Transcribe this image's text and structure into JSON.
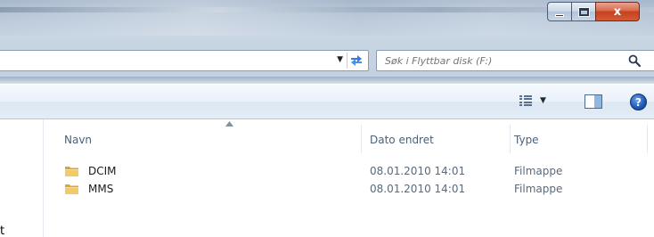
{
  "window": {
    "caption": {
      "minimize_icon": "minimize-icon",
      "maximize_icon": "maximize-icon",
      "close_label": "x"
    }
  },
  "address_bar": {
    "dropdown_icon": "chevron-down-icon",
    "refresh_icon": "refresh-icon"
  },
  "search": {
    "placeholder": "Søk i Flyttbar disk (F:)",
    "icon": "search-icon"
  },
  "command_bar": {
    "views_icon": "views-icon",
    "views_arrow": "▼",
    "preview_icon": "preview-pane-icon",
    "help_label": "?"
  },
  "columns": {
    "name": "Navn",
    "date": "Dato endret",
    "type": "Type",
    "sort_indicator": "^"
  },
  "files": [
    {
      "name": "DCIM",
      "date": "08.01.2010 14:01",
      "type": "Filmappe",
      "icon": "folder-icon"
    },
    {
      "name": "MMS",
      "date": "08.01.2010 14:01",
      "type": "Filmappe",
      "icon": "folder-icon"
    }
  ],
  "nav_fragment": "t",
  "colors": {
    "titlebar": "#b9c8d9",
    "close_button": "#c7401f",
    "command_bar": "#e9f1f9",
    "header_text": "#4c607a",
    "folder": "#e8b84a"
  }
}
